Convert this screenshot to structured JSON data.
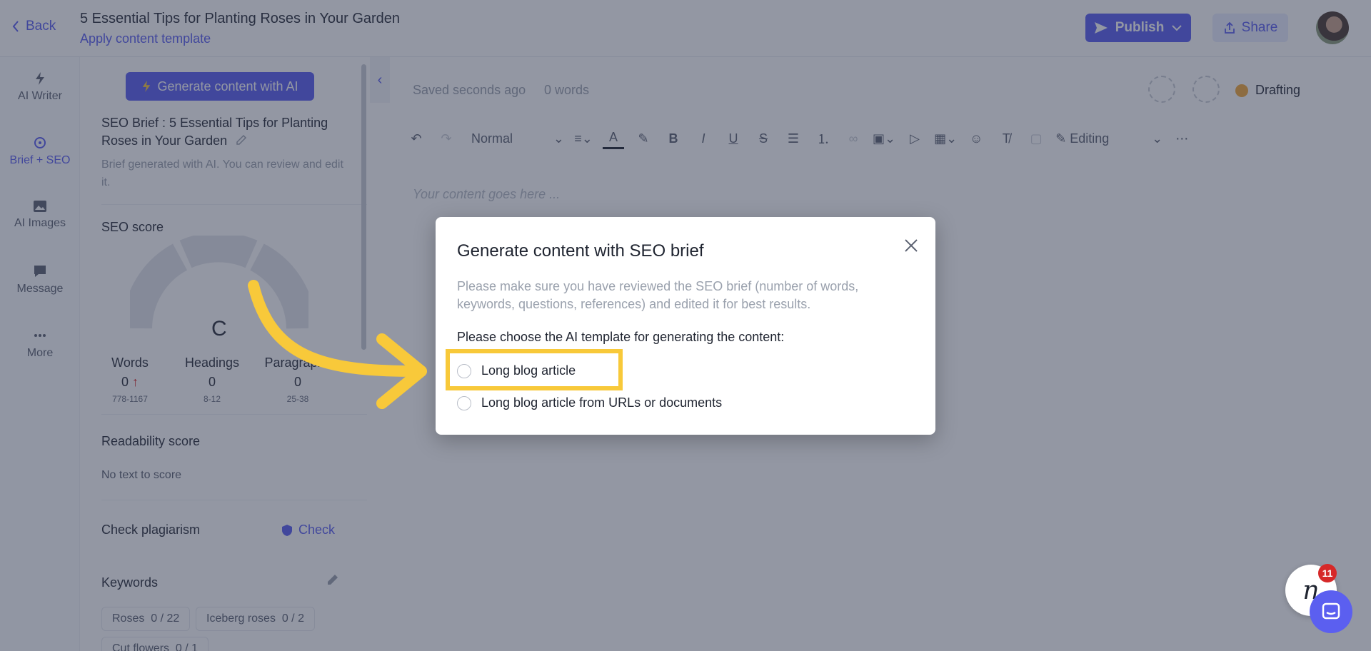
{
  "header": {
    "back_label": "Back",
    "title": "5 Essential Tips for Planting Roses in Your Garden",
    "template_link": "Apply content template",
    "publish_label": "Publish",
    "share_label": "Share"
  },
  "rail": {
    "items": [
      {
        "label": "AI Writer",
        "icon": "lightning-icon"
      },
      {
        "label": "Brief + SEO",
        "icon": "crosshair-icon",
        "active": true
      },
      {
        "label": "AI Images",
        "icon": "image-icon"
      },
      {
        "label": "Message",
        "icon": "message-icon"
      },
      {
        "label": "More",
        "icon": "more-dots-icon"
      }
    ]
  },
  "brief": {
    "generate_label": "Generate content with AI",
    "title": "SEO Brief : 5 Essential Tips for Planting Roses in Your Garden",
    "description": "Brief generated with AI. You can review and edit it.",
    "seo_score_title": "SEO score",
    "grade": "C",
    "stats": [
      {
        "label": "Words",
        "value": "0",
        "range": "778-1167"
      },
      {
        "label": "Headings",
        "value": "0",
        "range": "8-12"
      },
      {
        "label": "Paragraphs",
        "value": "0",
        "range": "25-38"
      }
    ],
    "readability_title": "Readability score",
    "readability_text": "No text to score",
    "plagiarism_title": "Check plagiarism",
    "check_label": "Check",
    "keywords_title": "Keywords",
    "keywords": [
      {
        "name": "Roses",
        "count": "0 / 22"
      },
      {
        "name": "Iceberg roses",
        "count": "0 / 2"
      },
      {
        "name": "Cut flowers",
        "count": "0 / 1"
      }
    ]
  },
  "editor": {
    "saved_text": "Saved seconds ago",
    "words_text": "0 words",
    "status": "Drafting",
    "status_color": "#f2a93b",
    "paragraph_style": "Normal",
    "mode": "Editing",
    "placeholder": "Your content goes here ..."
  },
  "modal": {
    "title": "Generate content with SEO brief",
    "note": "Please make sure you have reviewed the SEO brief (number of words, keywords, questions, references) and edited it for best results.",
    "prompt": "Please choose the AI template for generating the content:",
    "options": [
      {
        "label": "Long blog article",
        "selected": false
      },
      {
        "label": "Long blog article from URLs or documents",
        "selected": false
      }
    ]
  },
  "widgets": {
    "notification_count": "11",
    "logo_letter": "n"
  },
  "colors": {
    "accent": "#5b5ff0",
    "highlight": "#f8c93a",
    "overlay": "rgba(40,48,72,0.5)"
  }
}
